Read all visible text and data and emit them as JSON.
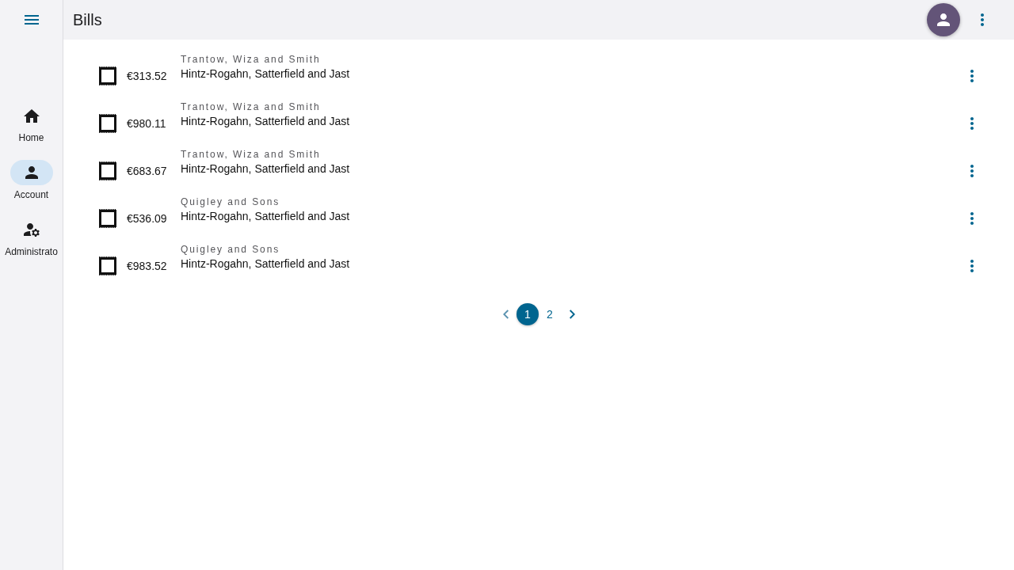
{
  "nav_items": [
    {
      "kind": "home",
      "label": "Home",
      "selected": false
    },
    {
      "kind": "account",
      "label": "Account",
      "selected": true
    },
    {
      "kind": "admin",
      "label": "Administrato",
      "selected": false
    }
  ],
  "header": {
    "title": "Bills"
  },
  "bills": [
    {
      "amount": "€313.52",
      "overline": "Trantow, Wiza and Smith",
      "title": "Hintz-Rogahn, Satterfield and Jast"
    },
    {
      "amount": "€980.11",
      "overline": "Trantow, Wiza and Smith",
      "title": "Hintz-Rogahn, Satterfield and Jast"
    },
    {
      "amount": "€683.67",
      "overline": "Trantow, Wiza and Smith",
      "title": "Hintz-Rogahn, Satterfield and Jast"
    },
    {
      "amount": "€536.09",
      "overline": "Quigley and Sons",
      "title": "Hintz-Rogahn, Satterfield and Jast"
    },
    {
      "amount": "€983.52",
      "overline": "Quigley and Sons",
      "title": "Hintz-Rogahn, Satterfield and Jast"
    }
  ],
  "pagination": {
    "prev_disabled": true,
    "next_disabled": false,
    "pages": [
      {
        "label": "1",
        "selected": true
      },
      {
        "label": "2",
        "selected": false
      }
    ]
  }
}
